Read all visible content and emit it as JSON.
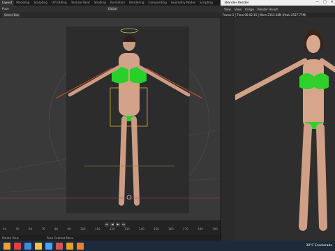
{
  "blender": {
    "workspace_tabs": [
      "Layout",
      "Modeling",
      "Sculpting",
      "UV Editing",
      "Texture Paint",
      "Shading",
      "Animation",
      "Rendering",
      "Compositing",
      "Geometry Nodes",
      "Scripting"
    ],
    "active_tab": "Layout",
    "mode_label": "Pose",
    "header_items": [
      "Select Box"
    ],
    "transform_orientation": "Global",
    "status_text": "Rotate View",
    "status_text2": "Pose Context Menu"
  },
  "timeline": {
    "frame_ticks": [
      "40",
      "50",
      "60",
      "70",
      "80",
      "90",
      "100",
      "110",
      "120",
      "130",
      "140",
      "150",
      "160",
      "170",
      "180",
      "190"
    ],
    "controls": [
      "⏮",
      "◀",
      "▶",
      "⏭"
    ]
  },
  "render_window": {
    "title": "Blender Render",
    "menu": [
      "View",
      "View",
      "Image",
      "Render Result"
    ],
    "info": "Frame:1 | Time:00:02.15 | Mem:2153.38M (Peak 2537.77M)",
    "window_controls": [
      "—",
      "□",
      "✕"
    ]
  },
  "taskbar": {
    "weather": "30°C  Ensolarado",
    "icon_colors": [
      "#f0a030",
      "#e04040",
      "#3a8fd8",
      "#f3c04c",
      "#4aa3ff",
      "#d9534f",
      "#e8a020",
      "#f08030"
    ]
  }
}
